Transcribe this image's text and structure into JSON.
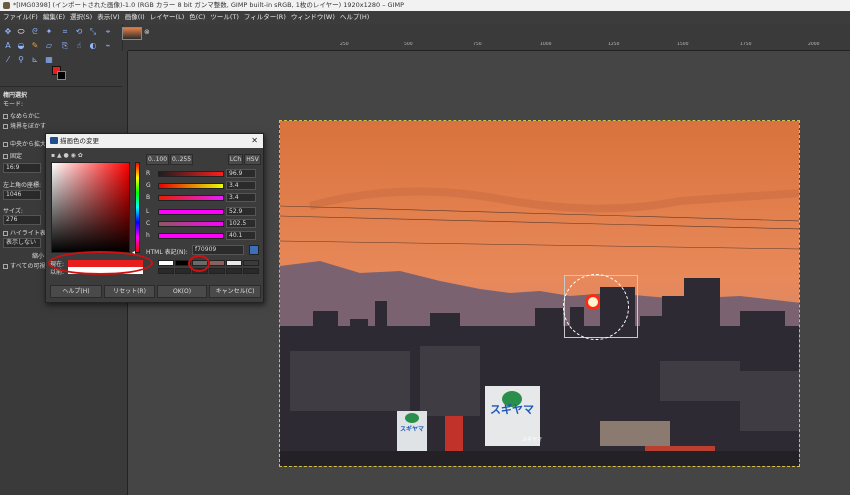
{
  "window_title": "*[IMG0398] (インポートされた画像)-1.0 (RGB カラー 8 bit ガンマ整数, GIMP built-in sRGB, 1枚のレイヤー) 1920x1280 – GIMP",
  "menu": [
    "ファイル(F)",
    "編集(E)",
    "選択(S)",
    "表示(V)",
    "画像(I)",
    "レイヤー(L)",
    "色(C)",
    "ツール(T)",
    "フィルター(R)",
    "ウィンドウ(W)",
    "ヘルプ(H)"
  ],
  "image_tab": {
    "close_glyph": "⊗"
  },
  "ruler_labels": [
    "250",
    "500",
    "750",
    "1000",
    "1250",
    "1500",
    "1750",
    "2000"
  ],
  "tool_options": {
    "title": "楕円選択",
    "mode_label": "モード:",
    "antialias": "なめらかに",
    "feather": "境界をぼかす",
    "expand_from_center": "中央から拡大",
    "fixed_label": "固定",
    "ratio_value": "16:9",
    "position_label": "左上角の座標:",
    "position_value": "1046",
    "size_label": "サイズ:",
    "size_value": "276",
    "highlight": "ハイライト表示",
    "guide_label": "表示しない",
    "auto_shrink": "縮小",
    "all_visible": "すべての可視"
  },
  "dialog": {
    "title": "描画色の変更",
    "range_btn_1": "0..100",
    "range_btn_2": "0..255",
    "lch_btn": "LCh",
    "hsv_btn": "HSV",
    "sliders": [
      {
        "label": "R",
        "value": "96.9",
        "gradient": "linear-gradient(to right,#1d1d1d,#ff1d1d)"
      },
      {
        "label": "G",
        "value": "3.4",
        "gradient": "linear-gradient(to right,#e80000,#e8ff00)"
      },
      {
        "label": "B",
        "value": "3.4",
        "gradient": "linear-gradient(to right,#e81d00,#e81dff)"
      },
      {
        "label": "L",
        "value": "52.9",
        "gradient": "linear-gradient(to right,#ff00ff,#ff00ff)"
      },
      {
        "label": "C",
        "value": "102.5",
        "gradient": "linear-gradient(to right,#8a5a5a,#ff00ff)"
      },
      {
        "label": "h",
        "value": "40.1",
        "gradient": "linear-gradient(to right,#ff00ff,#ff00ff)"
      }
    ],
    "hex_label": "HTML 表記(N):",
    "hex_value": "f70909",
    "now_label": "現在:",
    "prev_label": "以前:",
    "help_btn": "ヘルプ(H)",
    "reset_btn": "リセット(R)",
    "ok_btn": "OK(O)",
    "cancel_btn": "キャンセル(C)"
  },
  "colors": {
    "foreground": "#e81d1d",
    "background": "#000000",
    "current_swatch": "#e81d1d",
    "previous_swatch": "#ffffff",
    "annotation_ring": "#d01010"
  },
  "history_swatches": [
    "#ffffff",
    "#000000",
    "#6a6a6a",
    "#8a6060",
    "#e8e8e8",
    "#3b3b3b"
  ],
  "signs": [
    "スギヤマ",
    "スギヤマ",
    "スギヤマ"
  ]
}
